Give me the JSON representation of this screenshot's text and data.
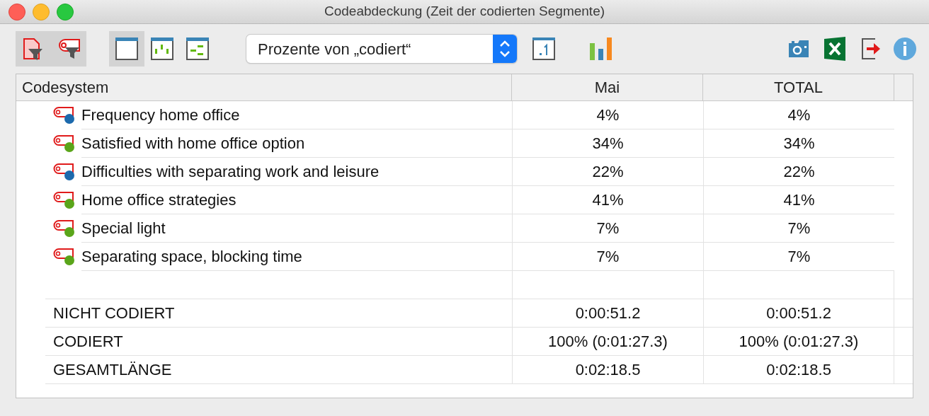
{
  "window": {
    "title": "Codeabdeckung (Zeit der codierten Segmente)"
  },
  "toolbar": {
    "filters": [
      {
        "kind": "document",
        "on": true
      },
      {
        "kind": "code",
        "on": true
      }
    ],
    "views": [
      {
        "kind": "plain",
        "selected": true
      },
      {
        "kind": "dots",
        "selected": false
      },
      {
        "kind": "dashes",
        "selected": false
      }
    ],
    "dropdown": {
      "value": "Prozente von „codiert“"
    }
  },
  "table": {
    "columns": [
      "Codesystem",
      "Mai",
      "TOTAL"
    ],
    "rows": [
      {
        "label": "Frequency home office",
        "color": "#1c6aad",
        "values": [
          "4%",
          "4%"
        ]
      },
      {
        "label": "Satisfied with home office option",
        "color": "#5aa51a",
        "values": [
          "34%",
          "34%"
        ]
      },
      {
        "label": "Difficulties with separating work and leisure",
        "color": "#1c6aad",
        "values": [
          "22%",
          "22%"
        ]
      },
      {
        "label": "Home office strategies",
        "color": "#5aa51a",
        "values": [
          "41%",
          "41%"
        ]
      },
      {
        "label": "Special light",
        "color": "#5aa51a",
        "values": [
          "7%",
          "7%"
        ]
      },
      {
        "label": "Separating space, blocking time",
        "color": "#5aa51a",
        "values": [
          "7%",
          "7%"
        ]
      }
    ],
    "summary": [
      {
        "label": "NICHT CODIERT",
        "values": [
          "0:00:51.2",
          "0:00:51.2"
        ]
      },
      {
        "label": "CODIERT",
        "values": [
          "100% (0:01:27.3)",
          "100% (0:01:27.3)"
        ]
      },
      {
        "label": "GESAMTLÄNGE",
        "values": [
          "0:02:18.5",
          "0:02:18.5"
        ]
      }
    ]
  }
}
